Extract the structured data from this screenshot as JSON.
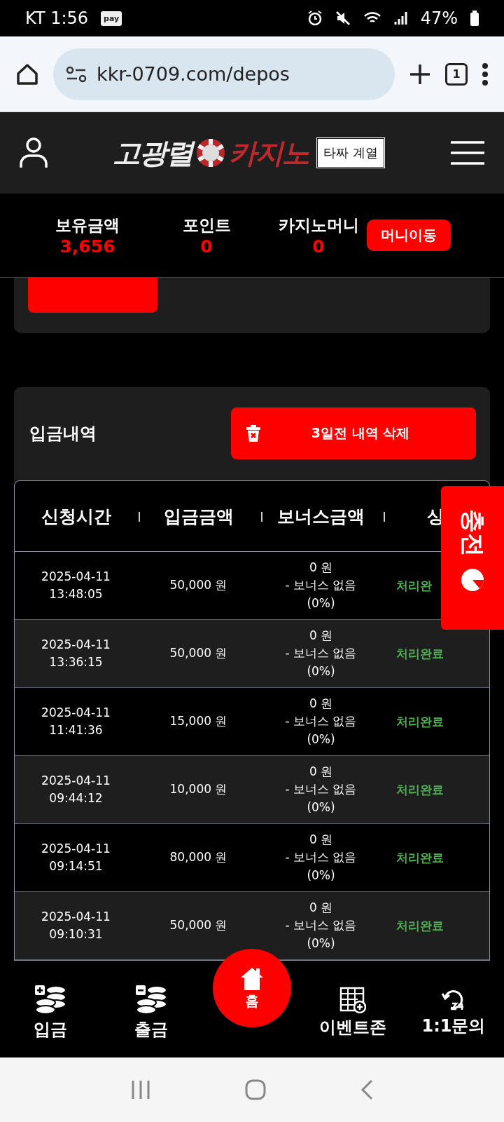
{
  "status_bar": {
    "carrier_time": "KT 1:56",
    "pay_badge": "pay",
    "battery": "47%"
  },
  "browser": {
    "url": "kkr-0709.com/depos",
    "tab_count": "1"
  },
  "header": {
    "logo_left": "고광렬",
    "logo_right": "카지노",
    "logo_tag": "타짜 계열"
  },
  "balances": [
    {
      "label": "보유금액",
      "value": "3,656"
    },
    {
      "label": "포인트",
      "value": "0"
    },
    {
      "label": "카지노머니",
      "value": "0"
    }
  ],
  "money_move_button": "머니이동",
  "history": {
    "title": "입금내역",
    "delete_button": "3일전 내역 삭제",
    "columns": [
      "신청시간",
      "입금금액",
      "보너스금액",
      "상"
    ],
    "rows": [
      {
        "date": "2025-04-11",
        "time": "13:48:05",
        "amount": "50,000 원",
        "bonus": "0 원",
        "bonus_note": "- 보너스 없음",
        "bonus_rate": "(0%)",
        "status": "처리완"
      },
      {
        "date": "2025-04-11",
        "time": "13:36:15",
        "amount": "50,000 원",
        "bonus": "0 원",
        "bonus_note": "- 보너스 없음",
        "bonus_rate": "(0%)",
        "status": "처리완료"
      },
      {
        "date": "2025-04-11",
        "time": "11:41:36",
        "amount": "15,000 원",
        "bonus": "0 원",
        "bonus_note": "- 보너스 없음",
        "bonus_rate": "(0%)",
        "status": "처리완료"
      },
      {
        "date": "2025-04-11",
        "time": "09:44:12",
        "amount": "10,000 원",
        "bonus": "0 원",
        "bonus_note": "- 보너스 없음",
        "bonus_rate": "(0%)",
        "status": "처리완료"
      },
      {
        "date": "2025-04-11",
        "time": "09:14:51",
        "amount": "80,000 원",
        "bonus": "0 원",
        "bonus_note": "- 보너스 없음",
        "bonus_rate": "(0%)",
        "status": "처리완료"
      },
      {
        "date": "2025-04-11",
        "time": "09:10:31",
        "amount": "50,000 원",
        "bonus": "0 원",
        "bonus_note": "- 보너스 없음",
        "bonus_rate": "(0%)",
        "status": "처리완료"
      }
    ]
  },
  "side_tab": {
    "label": "충전"
  },
  "bottom_nav": [
    {
      "kind": "deposit",
      "label": "입금"
    },
    {
      "kind": "withdraw",
      "label": "출금"
    },
    {
      "kind": "home",
      "label": "홈"
    },
    {
      "kind": "event",
      "label": "이벤트존"
    },
    {
      "kind": "support",
      "label": "1:1문의"
    }
  ]
}
